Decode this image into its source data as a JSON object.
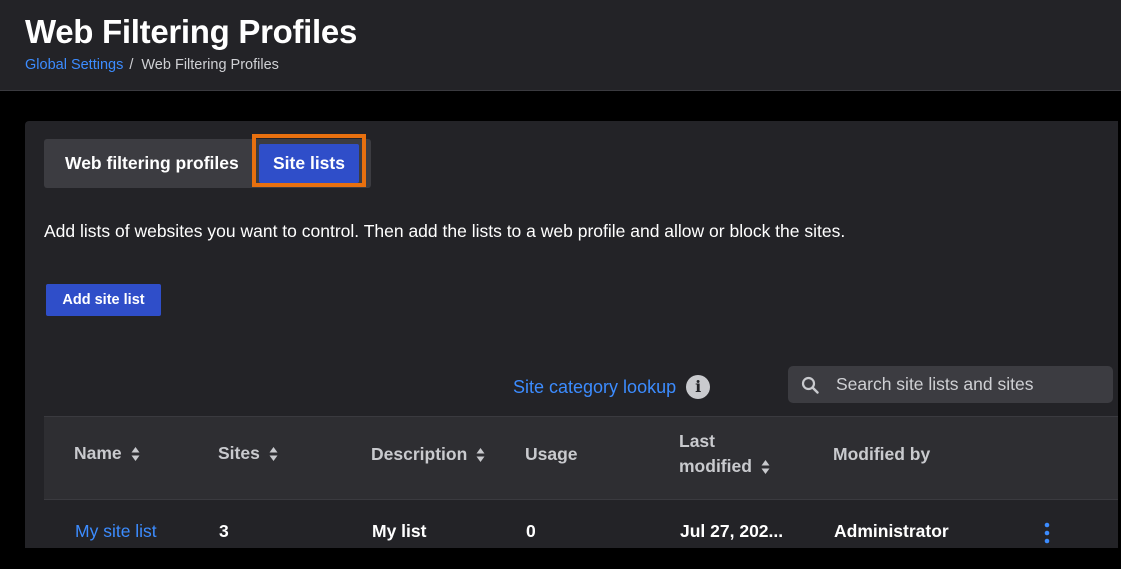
{
  "header": {
    "title": "Web Filtering Profiles",
    "breadcrumb": {
      "parent": "Global Settings",
      "separator": "/",
      "current": "Web Filtering Profiles"
    }
  },
  "tabs": [
    {
      "label": "Web filtering profiles",
      "active": false
    },
    {
      "label": "Site lists",
      "active": true
    }
  ],
  "intro": "Add lists of websites you want to control. Then add the lists to a web profile and allow or block the sites.",
  "add_button": "Add site list",
  "lookup": {
    "label": "Site category lookup",
    "icon": "info-icon"
  },
  "search": {
    "placeholder": "Search site lists and sites",
    "value": "",
    "icon": "search-icon"
  },
  "table": {
    "columns": {
      "name": "Name",
      "sites": "Sites",
      "description": "Description",
      "usage": "Usage",
      "last_modified_1": "Last",
      "last_modified_2": "modified",
      "modified_by": "Modified by"
    },
    "rows": [
      {
        "name": "My site list",
        "sites": "3",
        "description": "My list",
        "usage": "0",
        "last_modified": "Jul 27, 202...",
        "modified_by": "Administrator"
      }
    ]
  },
  "colors": {
    "accent_blue": "#2f4ec9",
    "link_blue": "#3c8cff",
    "highlight_orange": "#e8700f",
    "panel_bg": "#232327"
  }
}
